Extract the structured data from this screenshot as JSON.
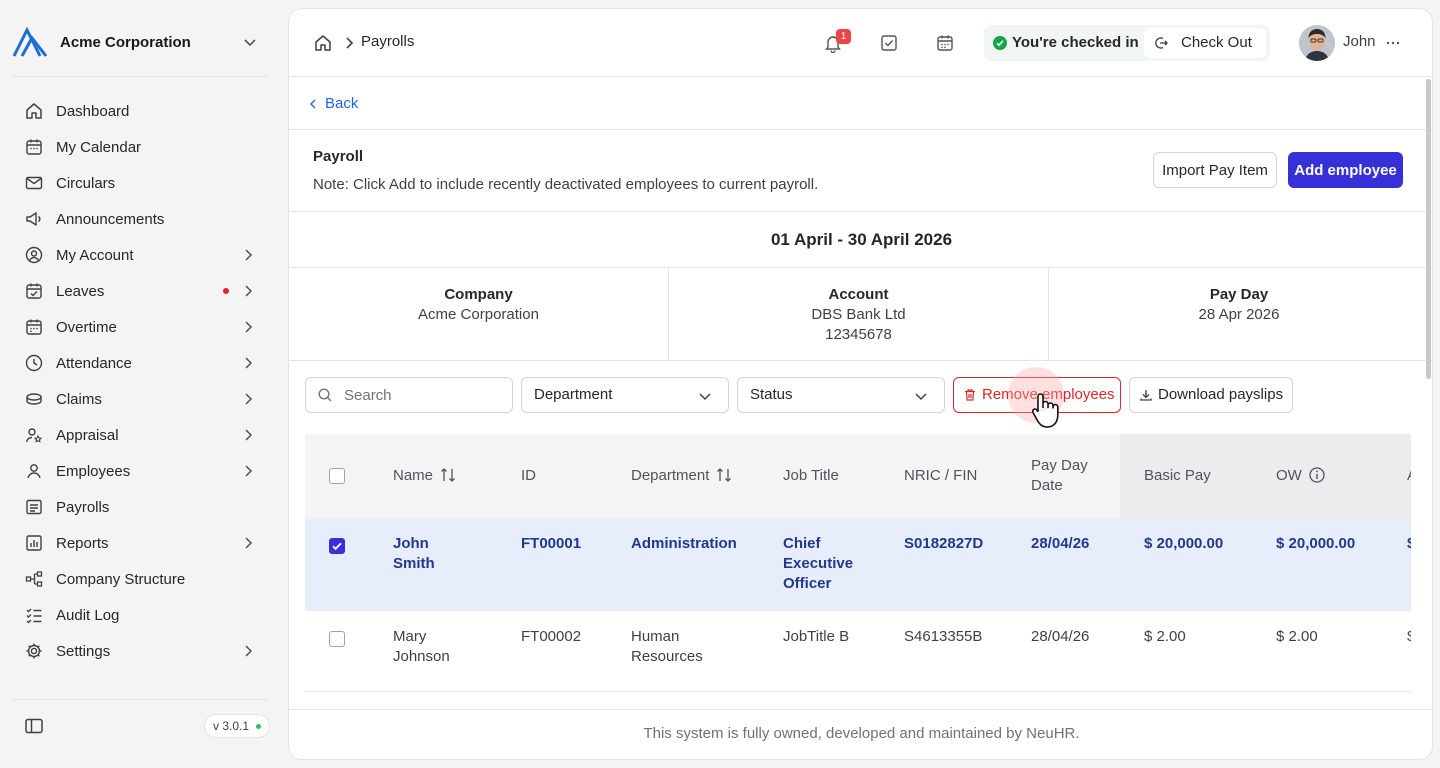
{
  "sidebar": {
    "org_name": "Acme Corporation",
    "version": "v 3.0.1",
    "items": [
      {
        "label": "Dashboard",
        "icon": "home-icon"
      },
      {
        "label": "My Calendar",
        "icon": "calendar-icon"
      },
      {
        "label": "Circulars",
        "icon": "mail-icon"
      },
      {
        "label": "Announcements",
        "icon": "megaphone-icon"
      },
      {
        "label": "My Account",
        "icon": "user-circle-icon"
      },
      {
        "label": "Leaves",
        "icon": "calendar-check-icon"
      },
      {
        "label": "Overtime",
        "icon": "calendar-clock-icon"
      },
      {
        "label": "Attendance",
        "icon": "clock-icon"
      },
      {
        "label": "Claims",
        "icon": "coins-icon"
      },
      {
        "label": "Appraisal",
        "icon": "user-star-icon"
      },
      {
        "label": "Employees",
        "icon": "user-icon"
      },
      {
        "label": "Payrolls",
        "icon": "receipt-icon"
      },
      {
        "label": "Reports",
        "icon": "report-icon"
      },
      {
        "label": "Company Structure",
        "icon": "org-chart-icon"
      },
      {
        "label": "Audit Log",
        "icon": "list-check-icon"
      },
      {
        "label": "Settings",
        "icon": "gear-icon"
      }
    ]
  },
  "topbar": {
    "breadcrumb": "Payrolls",
    "notification_count": "1",
    "checkin_status": "You're checked in",
    "checkout_label": "Check Out",
    "user_name": "John"
  },
  "back_label": "Back",
  "payroll": {
    "title": "Payroll",
    "note": "Note: Click Add to include recently deactivated employees to current payroll.",
    "import_label": "Import Pay Item",
    "add_label": "Add employee",
    "period": "01 April - 30 April 2026"
  },
  "info": {
    "company_label": "Company",
    "company_value": "Acme Corporation",
    "account_label": "Account",
    "account_bank": "DBS Bank Ltd",
    "account_number": "12345678",
    "payday_label": "Pay Day",
    "payday_value": "28 Apr 2026"
  },
  "filters": {
    "search_placeholder": "Search",
    "department_label": "Department",
    "status_label": "Status",
    "remove_label": "Remove employees",
    "download_label": "Download payslips"
  },
  "table": {
    "columns": [
      "Name",
      "ID",
      "Department",
      "Job Title",
      "NRIC / FIN",
      "Pay Day Date",
      "Basic Pay",
      "OW"
    ],
    "rows": [
      {
        "selected": true,
        "name": "John Smith",
        "id": "FT00001",
        "department": "Administration",
        "job_title": "Chief Executive Officer",
        "nric": "S0182827D",
        "pay_date": "28/04/26",
        "basic_pay": "$ 20,000.00",
        "ow": "$ 20,000.00"
      },
      {
        "selected": false,
        "name": "Mary Johnson",
        "id": "FT00002",
        "department": "Human Resources",
        "job_title": "JobTitle B",
        "nric": "S4613355B",
        "pay_date": "28/04/26",
        "basic_pay": "$ 2.00",
        "ow": "$ 2.00"
      }
    ]
  },
  "footer": "This system is fully owned, developed and maintained by NeuHR.",
  "colors": {
    "accent": "#3730d6",
    "danger": "#dc2626",
    "success": "#16a34a",
    "selected_row": "#e8edfb"
  }
}
